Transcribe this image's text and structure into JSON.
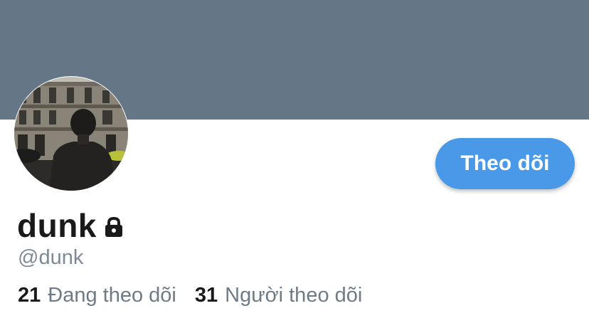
{
  "profile": {
    "display_name": "dunk",
    "handle": "@dunk",
    "locked": true,
    "avatar_icon": "profile-photo"
  },
  "actions": {
    "follow_label": "Theo dõi"
  },
  "stats": {
    "following_count": "21",
    "following_label": "Đang theo dõi",
    "followers_count": "31",
    "followers_label": "Người theo dõi"
  },
  "colors": {
    "banner": "#657786",
    "accent": "#4a99e9",
    "text": "#1a1a1a",
    "muted": "#7d8a96"
  }
}
